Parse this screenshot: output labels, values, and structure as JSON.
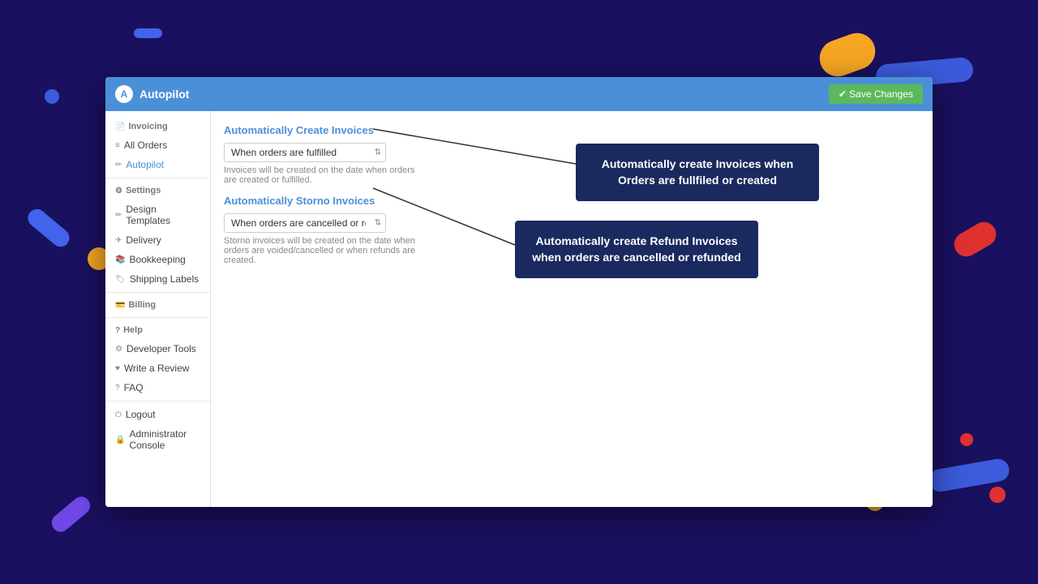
{
  "app": {
    "title": "Autopilot",
    "save_button_label": "✔ Save Changes"
  },
  "sidebar": {
    "invoicing_label": "Invoicing",
    "items": [
      {
        "id": "all-orders",
        "label": "All Orders",
        "icon": "≡"
      },
      {
        "id": "autopilot",
        "label": "Autopilot",
        "icon": "✏"
      },
      {
        "id": "settings",
        "label": "Settings",
        "icon": "⚙"
      },
      {
        "id": "design-templates",
        "label": "Design Templates",
        "icon": "✏"
      },
      {
        "id": "delivery",
        "label": "Delivery",
        "icon": "✈"
      },
      {
        "id": "bookkeeping",
        "label": "Bookkeeping",
        "icon": "📚"
      },
      {
        "id": "shipping-labels",
        "label": "Shipping Labels",
        "icon": "🏷"
      },
      {
        "id": "billing",
        "label": "Billing",
        "icon": "💳"
      },
      {
        "id": "help",
        "label": "Help",
        "icon": "?"
      },
      {
        "id": "developer-tools",
        "label": "Developer Tools",
        "icon": "⚙"
      },
      {
        "id": "write-review",
        "label": "Write a Review",
        "icon": "♥"
      },
      {
        "id": "faq",
        "label": "FAQ",
        "icon": "?"
      },
      {
        "id": "logout",
        "label": "Logout",
        "icon": "⏻"
      },
      {
        "id": "admin-console",
        "label": "Administrator Console",
        "icon": "🔒"
      }
    ]
  },
  "main": {
    "section1": {
      "title": "Automatically Create Invoices",
      "select_value": "When orders are fulfilled",
      "description": "Invoices will be created on the date when orders are created or fulfilled."
    },
    "section2": {
      "title": "Automatically Storno Invoices",
      "select_value": "When orders are cancelled or refunded",
      "description": "Storno invoices will be created on the date when orders are voided/cancelled or when refunds are created."
    },
    "tooltip1": {
      "text": "Automatically create Invoices when Orders are fullfiled or created"
    },
    "tooltip2": {
      "text": "Automatically create Refund Invoices when orders are cancelled or refunded"
    }
  }
}
